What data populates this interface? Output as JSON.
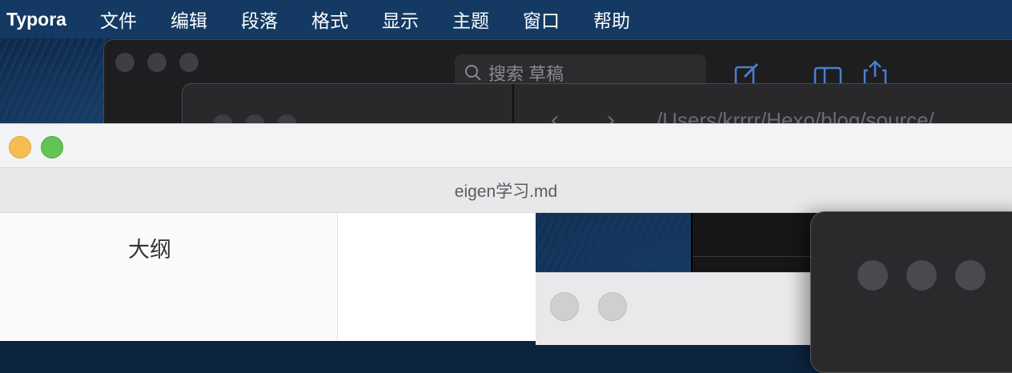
{
  "menubar": {
    "app_name": "Typora",
    "items": [
      "文件",
      "编辑",
      "段落",
      "格式",
      "显示",
      "主题",
      "窗口",
      "帮助"
    ]
  },
  "background_window": {
    "search_placeholder": "搜索 草稿",
    "path_text": "/Users/krrrr/Hexo/blog/source/"
  },
  "document": {
    "tab_title": "eigen学习.md",
    "sidebar_title": "大纲"
  },
  "colors": {
    "menubar": "#143a63",
    "traffic_yellow": "#f5bd4f",
    "traffic_green": "#61c454",
    "accent_blue": "#4a7fd0"
  }
}
